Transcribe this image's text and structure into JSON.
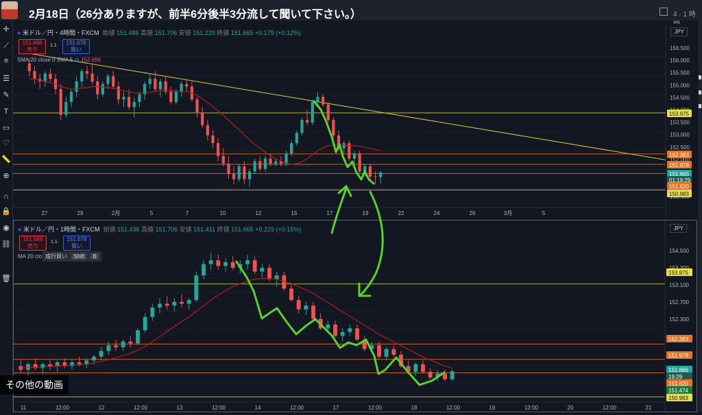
{
  "video": {
    "title": "2月18日（26分ありますが、前半6分後半3分流して聞いて下さい。）",
    "layout_indicator": "4 · 1 時間",
    "other_videos_label": "その他の動画"
  },
  "colors": {
    "bg": "#131722",
    "up": "#26a69a",
    "down": "#ef5350",
    "ma": "#b71c1c",
    "yellow_line": "#d4c84a",
    "orange_line": "#e8742a",
    "arrow": "#5ad12d"
  },
  "chart_top": {
    "symbol": "米ドル／円・4時間・FXCM",
    "ohlc": {
      "open_label": "始値",
      "open": "151.486",
      "high_label": "高値",
      "high": "151.706",
      "low_label": "安値",
      "low": "151.229",
      "close_label": "終値",
      "close": "151.665",
      "change": "+0.179 (+0.12%)"
    },
    "sell_price": "151.666",
    "sell_label": "売り",
    "buy_price": "151.678",
    "buy_label": "買い",
    "spread": "1.1",
    "indicator": "SMA 20 close 0 SMA 5",
    "indicator_value": "152.698",
    "currency": "JPY",
    "y_ticks": [
      "156.500",
      "156.000",
      "155.500",
      "155.000",
      "154.500",
      "154.000",
      "153.500",
      "153.000",
      "152.500",
      "152.000",
      "151.500",
      "151.000",
      "150.500"
    ],
    "x_ticks": [
      "27",
      "29",
      "2月",
      "5",
      "7",
      "10",
      "12",
      "15",
      "17",
      "19",
      "22",
      "24",
      "26",
      "3月",
      "5"
    ],
    "price_tags": [
      {
        "text": "153.975",
        "kind": "yellow"
      },
      {
        "text": "152.383",
        "kind": "orange"
      },
      {
        "text": "151.978",
        "kind": "orange"
      },
      {
        "text": "151.665",
        "kind": "current"
      },
      {
        "text": "01:19:29",
        "kind": "timer"
      },
      {
        "text": "151.620",
        "kind": "orange"
      },
      {
        "text": "150.983",
        "kind": "yellow"
      }
    ],
    "chart_data": {
      "type": "candlestick",
      "y_range": [
        150.3,
        156.9
      ],
      "trend_line": {
        "from": [
          0,
          156.3
        ],
        "to": [
          1,
          152.15
        ]
      },
      "horizontal_levels": [
        {
          "price": 153.975,
          "color": "yellow"
        },
        {
          "price": 152.383,
          "color": "orange"
        },
        {
          "price": 151.978,
          "color": "orange"
        },
        {
          "price": 151.62,
          "color": "orange"
        },
        {
          "price": 150.983,
          "color": "yellow"
        }
      ],
      "candles_ohlc": [
        [
          155.9,
          156.1,
          155.4,
          155.6
        ],
        [
          155.6,
          155.8,
          155.1,
          155.3
        ],
        [
          155.3,
          155.5,
          154.9,
          155.2
        ],
        [
          155.2,
          155.6,
          155.0,
          155.5
        ],
        [
          155.5,
          155.7,
          155.2,
          155.3
        ],
        [
          155.3,
          155.5,
          154.7,
          154.9
        ],
        [
          154.9,
          155.1,
          153.7,
          153.9
        ],
        [
          153.9,
          154.6,
          153.8,
          154.4
        ],
        [
          154.4,
          154.9,
          154.2,
          154.8
        ],
        [
          154.8,
          155.4,
          154.6,
          155.2
        ],
        [
          155.2,
          155.7,
          155.0,
          155.6
        ],
        [
          155.6,
          155.8,
          155.3,
          155.5
        ],
        [
          155.5,
          155.9,
          155.1,
          155.2
        ],
        [
          155.2,
          155.4,
          154.5,
          154.7
        ],
        [
          154.7,
          155.2,
          154.6,
          155.1
        ],
        [
          155.1,
          155.5,
          154.9,
          155.4
        ],
        [
          155.4,
          155.6,
          154.9,
          155.0
        ],
        [
          155.0,
          155.2,
          154.3,
          154.5
        ],
        [
          154.5,
          154.8,
          154.2,
          154.6
        ],
        [
          154.6,
          154.9,
          154.1,
          154.2
        ],
        [
          154.2,
          154.6,
          153.8,
          154.4
        ],
        [
          154.4,
          154.8,
          154.2,
          154.7
        ],
        [
          154.7,
          155.2,
          154.5,
          155.1
        ],
        [
          155.1,
          155.5,
          154.9,
          155.3
        ],
        [
          155.3,
          155.6,
          154.8,
          154.9
        ],
        [
          154.9,
          155.3,
          154.6,
          155.2
        ],
        [
          155.2,
          155.4,
          154.7,
          154.8
        ],
        [
          154.8,
          155.0,
          154.3,
          154.4
        ],
        [
          154.4,
          154.9,
          154.3,
          154.8
        ],
        [
          154.8,
          155.2,
          154.6,
          155.1
        ],
        [
          155.1,
          155.3,
          154.8,
          155.0
        ],
        [
          155.0,
          155.2,
          154.4,
          154.5
        ],
        [
          154.5,
          154.6,
          153.8,
          154.0
        ],
        [
          154.0,
          154.2,
          153.4,
          153.5
        ],
        [
          153.5,
          153.7,
          152.9,
          153.1
        ],
        [
          153.1,
          153.3,
          152.6,
          152.8
        ],
        [
          152.8,
          153.0,
          152.1,
          152.3
        ],
        [
          152.3,
          152.6,
          151.9,
          152.0
        ],
        [
          152.0,
          152.3,
          151.4,
          151.6
        ],
        [
          151.6,
          151.9,
          151.2,
          151.4
        ],
        [
          151.4,
          152.0,
          151.3,
          151.9
        ],
        [
          151.9,
          152.1,
          151.2,
          151.4
        ],
        [
          151.4,
          151.8,
          151.1,
          151.7
        ],
        [
          151.7,
          152.2,
          151.6,
          152.1
        ],
        [
          152.1,
          152.3,
          151.7,
          151.8
        ],
        [
          151.8,
          152.3,
          151.7,
          152.2
        ],
        [
          152.2,
          152.4,
          151.9,
          152.0
        ],
        [
          152.0,
          152.2,
          151.9,
          152.1
        ],
        [
          152.1,
          152.3,
          151.9,
          152.0
        ],
        [
          152.0,
          152.5,
          151.9,
          152.4
        ],
        [
          152.4,
          152.9,
          152.3,
          152.8
        ],
        [
          152.8,
          153.3,
          152.7,
          153.2
        ],
        [
          153.2,
          153.8,
          153.1,
          153.7
        ],
        [
          153.7,
          154.1,
          153.5,
          153.6
        ],
        [
          153.6,
          154.5,
          153.5,
          154.4
        ],
        [
          154.4,
          154.8,
          154.2,
          154.6
        ],
        [
          154.6,
          154.7,
          154.2,
          154.3
        ],
        [
          154.3,
          154.4,
          153.6,
          153.7
        ],
        [
          153.7,
          153.8,
          153.0,
          153.1
        ],
        [
          153.1,
          153.3,
          152.5,
          152.6
        ],
        [
          152.6,
          152.9,
          152.4,
          152.8
        ],
        [
          152.8,
          152.9,
          152.1,
          152.2
        ],
        [
          152.2,
          152.5,
          151.9,
          152.4
        ],
        [
          152.4,
          152.5,
          151.6,
          151.7
        ],
        [
          151.7,
          152.0,
          151.5,
          151.9
        ],
        [
          151.9,
          152.0,
          151.4,
          151.5
        ],
        [
          151.5,
          151.7,
          151.2,
          151.486
        ],
        [
          151.486,
          151.706,
          151.229,
          151.665
        ]
      ],
      "ma20": [
        155.3,
        155.3,
        155.25,
        155.2,
        155.15,
        155.1,
        155.0,
        154.95,
        154.9,
        154.9,
        154.95,
        154.95,
        155.0,
        155.0,
        154.98,
        154.96,
        154.93,
        154.88,
        154.84,
        154.8,
        154.76,
        154.74,
        154.75,
        154.78,
        154.82,
        154.85,
        154.86,
        154.84,
        154.82,
        154.8,
        154.8,
        154.75,
        154.65,
        154.52,
        154.38,
        154.22,
        154.05,
        153.88,
        153.7,
        153.5,
        153.32,
        153.12,
        152.92,
        152.75,
        152.6,
        152.45,
        152.32,
        152.2,
        152.1,
        152.02,
        151.98,
        152.0,
        152.08,
        152.2,
        152.35,
        152.5,
        152.62,
        152.7,
        152.74,
        152.74,
        152.72,
        152.7,
        152.7,
        152.68,
        152.64,
        152.6,
        152.55,
        152.5
      ]
    }
  },
  "chart_bottom": {
    "symbol": "米ドル／円・1時間・FXCM",
    "ohlc": {
      "open_label": "始値",
      "open": "151.436",
      "high_label": "高値",
      "high": "151.706",
      "low_label": "安値",
      "low": "151.411",
      "close_label": "終値",
      "close": "151.665",
      "change": "+0.229 (+0.15%)"
    },
    "sell_price": "151.666",
    "sell_label": "売り",
    "buy_price": "151.678",
    "buy_label": "買い",
    "spread": "1.1",
    "indicator": "MA 20 clo",
    "tooltip_text": "成行買い",
    "tooltip_key1": "Shift",
    "tooltip_key2": "B",
    "currency": "JPY",
    "y_ticks": [
      "154.500",
      "153.300",
      "153.100",
      "152.700",
      "152.300"
    ],
    "x_ticks": [
      "11",
      "12:00",
      "12",
      "12:00",
      "13",
      "12:00",
      "14",
      "12:00",
      "17",
      "12:00",
      "18",
      "12:00",
      "19",
      "12:00",
      "20",
      "12:00",
      "21"
    ],
    "price_tags": [
      {
        "text": "153.975",
        "kind": "yellow"
      },
      {
        "text": "152.383",
        "kind": "orange"
      },
      {
        "text": "151.978",
        "kind": "orange"
      },
      {
        "text": "151.666",
        "kind": "current"
      },
      {
        "text": "19:29",
        "kind": "timer"
      },
      {
        "text": "151.620",
        "kind": "orange"
      },
      {
        "text": "151.474",
        "kind": "green"
      },
      {
        "text": "150.983",
        "kind": "yellow"
      }
    ],
    "chart_data": {
      "type": "candlestick",
      "y_range": [
        150.85,
        155.2
      ],
      "horizontal_levels": [
        {
          "price": 153.975,
          "color": "yellow"
        },
        {
          "price": 152.383,
          "color": "orange"
        },
        {
          "price": 151.978,
          "color": "orange"
        },
        {
          "price": 151.62,
          "color": "orange"
        },
        {
          "price": 150.983,
          "color": "yellow"
        }
      ],
      "candles_ohlc": [
        [
          151.8,
          151.95,
          151.6,
          151.7
        ],
        [
          151.7,
          151.9,
          151.55,
          151.85
        ],
        [
          151.85,
          152.0,
          151.7,
          151.75
        ],
        [
          151.75,
          151.9,
          151.6,
          151.85
        ],
        [
          151.85,
          151.95,
          151.7,
          151.8
        ],
        [
          151.8,
          151.95,
          151.65,
          151.9
        ],
        [
          151.9,
          152.0,
          151.75,
          151.8
        ],
        [
          151.8,
          151.95,
          151.7,
          151.9
        ],
        [
          151.9,
          152.05,
          151.8,
          151.85
        ],
        [
          151.85,
          152.0,
          151.75,
          151.95
        ],
        [
          151.95,
          152.1,
          151.85,
          152.05
        ],
        [
          152.05,
          152.3,
          151.95,
          152.2
        ],
        [
          152.2,
          152.45,
          152.1,
          152.35
        ],
        [
          152.35,
          152.5,
          152.2,
          152.3
        ],
        [
          152.3,
          152.5,
          152.2,
          152.45
        ],
        [
          152.45,
          152.6,
          152.3,
          152.4
        ],
        [
          152.4,
          152.8,
          152.35,
          152.75
        ],
        [
          152.75,
          153.2,
          152.7,
          153.1
        ],
        [
          153.1,
          153.45,
          153.0,
          153.35
        ],
        [
          153.35,
          153.6,
          153.2,
          153.45
        ],
        [
          153.45,
          153.65,
          153.3,
          153.4
        ],
        [
          153.4,
          153.6,
          153.25,
          153.5
        ],
        [
          153.5,
          153.7,
          153.35,
          153.45
        ],
        [
          153.45,
          153.6,
          153.3,
          153.55
        ],
        [
          153.55,
          154.3,
          153.5,
          154.2
        ],
        [
          154.2,
          154.6,
          154.1,
          154.5
        ],
        [
          154.5,
          154.8,
          154.35,
          154.6
        ],
        [
          154.6,
          154.75,
          154.35,
          154.45
        ],
        [
          154.45,
          154.65,
          154.3,
          154.55
        ],
        [
          154.55,
          154.7,
          154.35,
          154.4
        ],
        [
          154.4,
          154.6,
          154.25,
          154.5
        ],
        [
          154.5,
          154.75,
          154.35,
          154.6
        ],
        [
          154.6,
          154.7,
          154.25,
          154.3
        ],
        [
          154.3,
          154.5,
          154.15,
          154.4
        ],
        [
          154.4,
          154.5,
          154.05,
          154.1
        ],
        [
          154.1,
          154.3,
          153.9,
          154.2
        ],
        [
          154.2,
          154.3,
          153.8,
          153.85
        ],
        [
          153.85,
          154.0,
          153.5,
          153.55
        ],
        [
          153.55,
          153.65,
          153.2,
          153.3
        ],
        [
          153.3,
          153.5,
          153.15,
          153.4
        ],
        [
          153.4,
          153.5,
          153.0,
          153.05
        ],
        [
          153.05,
          153.2,
          152.75,
          152.8
        ],
        [
          152.8,
          153.0,
          152.7,
          152.9
        ],
        [
          152.9,
          153.0,
          152.55,
          152.6
        ],
        [
          152.6,
          152.8,
          152.45,
          152.7
        ],
        [
          152.7,
          152.9,
          152.6,
          152.8
        ],
        [
          152.8,
          152.9,
          152.45,
          152.5
        ],
        [
          152.5,
          152.6,
          152.2,
          152.25
        ],
        [
          152.25,
          152.45,
          152.15,
          152.35
        ],
        [
          152.35,
          152.45,
          152.0,
          152.05
        ],
        [
          152.05,
          152.3,
          151.95,
          152.25
        ],
        [
          152.25,
          152.35,
          152.05,
          152.1
        ],
        [
          152.1,
          152.2,
          151.75,
          151.8
        ],
        [
          151.8,
          151.95,
          151.6,
          151.65
        ],
        [
          151.65,
          151.9,
          151.55,
          151.85
        ],
        [
          151.85,
          151.95,
          151.6,
          151.65
        ],
        [
          151.65,
          151.75,
          151.45,
          151.5
        ],
        [
          151.5,
          151.7,
          151.4,
          151.6
        ],
        [
          151.6,
          151.7,
          151.4,
          151.45
        ],
        [
          151.45,
          151.706,
          151.411,
          151.665
        ]
      ],
      "ma20": [
        151.75,
        151.76,
        151.77,
        151.78,
        151.79,
        151.8,
        151.81,
        151.82,
        151.83,
        151.85,
        151.88,
        151.92,
        151.97,
        152.02,
        152.08,
        152.14,
        152.22,
        152.32,
        152.45,
        152.58,
        152.72,
        152.85,
        152.98,
        153.1,
        153.25,
        153.4,
        153.55,
        153.68,
        153.8,
        153.9,
        153.98,
        154.05,
        154.1,
        154.12,
        154.12,
        154.1,
        154.05,
        153.98,
        153.9,
        153.82,
        153.72,
        153.6,
        153.48,
        153.36,
        153.24,
        153.12,
        153.0,
        152.88,
        152.76,
        152.64,
        152.54,
        152.44,
        152.34,
        152.24,
        152.14,
        152.04,
        151.96,
        151.88,
        151.8,
        151.74
      ]
    }
  }
}
